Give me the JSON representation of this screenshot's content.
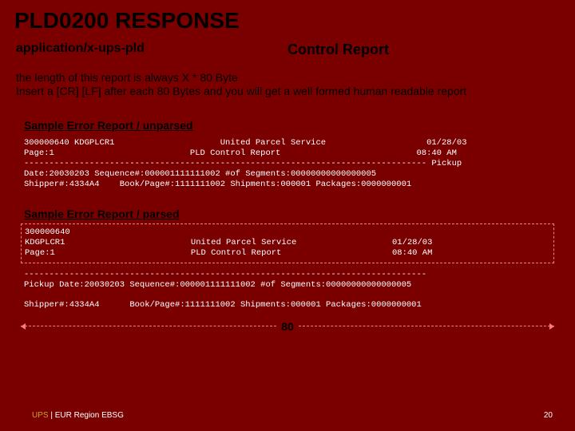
{
  "title": "PLD0200 RESPONSE",
  "subtitle_left": "application/x-ups-pld",
  "subtitle_right": "Control Report",
  "intro_line1": "the length of this report is always X * 80 Byte",
  "intro_line2": "Insert a [CR] [LF] after each 80 Bytes and you will get a well formed human readable report",
  "section1_label": "Sample Error Report / unparsed",
  "unparsed_report": "300000640 KDGPLCR1                     United Parcel Service                    01/28/03\nPage:1                           PLD Control Report                           08:40 AM\n-------------------------------------------------------------------------------- Pickup\nDate:20030203 Sequence#:000001111111002 #of Segments:00000000000000005\nShipper#:4334A4    Book/Page#:1111111002 Shipments:000001 Packages:0000000001",
  "section2_label": "Sample Error Report / parsed",
  "parsed_block1": "300000640\nKDGPLCR1                         United Parcel Service                   01/28/03\nPage:1                           PLD Control Report                      08:40 AM",
  "parsed_block2": "--------------------------------------------------------------------------------\nPickup Date:20030203 Sequence#:000001111111002 #of Segments:00000000000000005",
  "parsed_block3": "Shipper#:4334A4      Book/Page#:1111111002 Shipments:000001 Packages:0000000001",
  "measure_value": "80",
  "footer_left_brand": "UPS",
  "footer_left_sep": " | ",
  "footer_left_rest": "EUR Region EBSG",
  "footer_right": "20"
}
